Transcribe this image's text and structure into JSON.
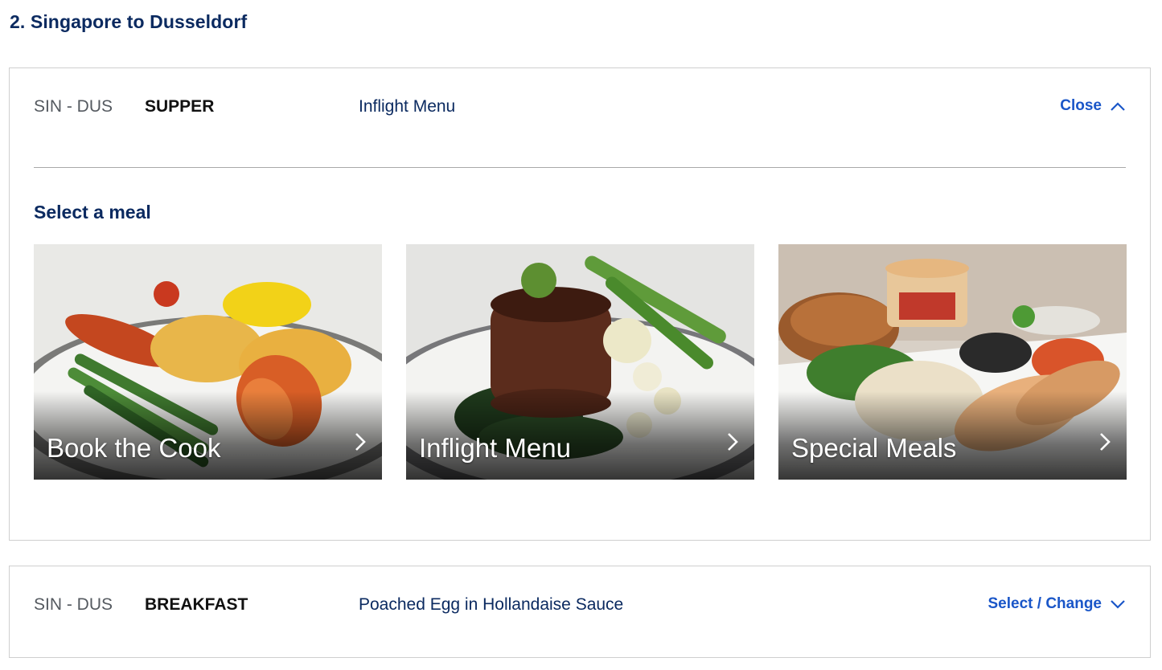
{
  "section": {
    "title": "2. Singapore to Dusseldorf"
  },
  "supper": {
    "route": "SIN - DUS",
    "meal_type": "SUPPER",
    "meal_name": "Inflight Menu",
    "toggle_label": "Close",
    "toggle_icon": "chevron-up-icon",
    "select_heading": "Select a meal",
    "options": [
      {
        "label": "Book the Cook",
        "icon": "chevron-right-icon"
      },
      {
        "label": "Inflight Menu",
        "icon": "chevron-right-icon"
      },
      {
        "label": "Special Meals",
        "icon": "chevron-right-icon"
      }
    ]
  },
  "breakfast": {
    "route": "SIN - DUS",
    "meal_type": "BREAKFAST",
    "meal_name": "Poached Egg in Hollandaise Sauce",
    "toggle_label": "Select / Change",
    "toggle_icon": "chevron-down-icon"
  },
  "colors": {
    "heading": "#0b2a60",
    "link": "#1a56c8",
    "route": "#555a60",
    "border": "#cfcfcf"
  }
}
